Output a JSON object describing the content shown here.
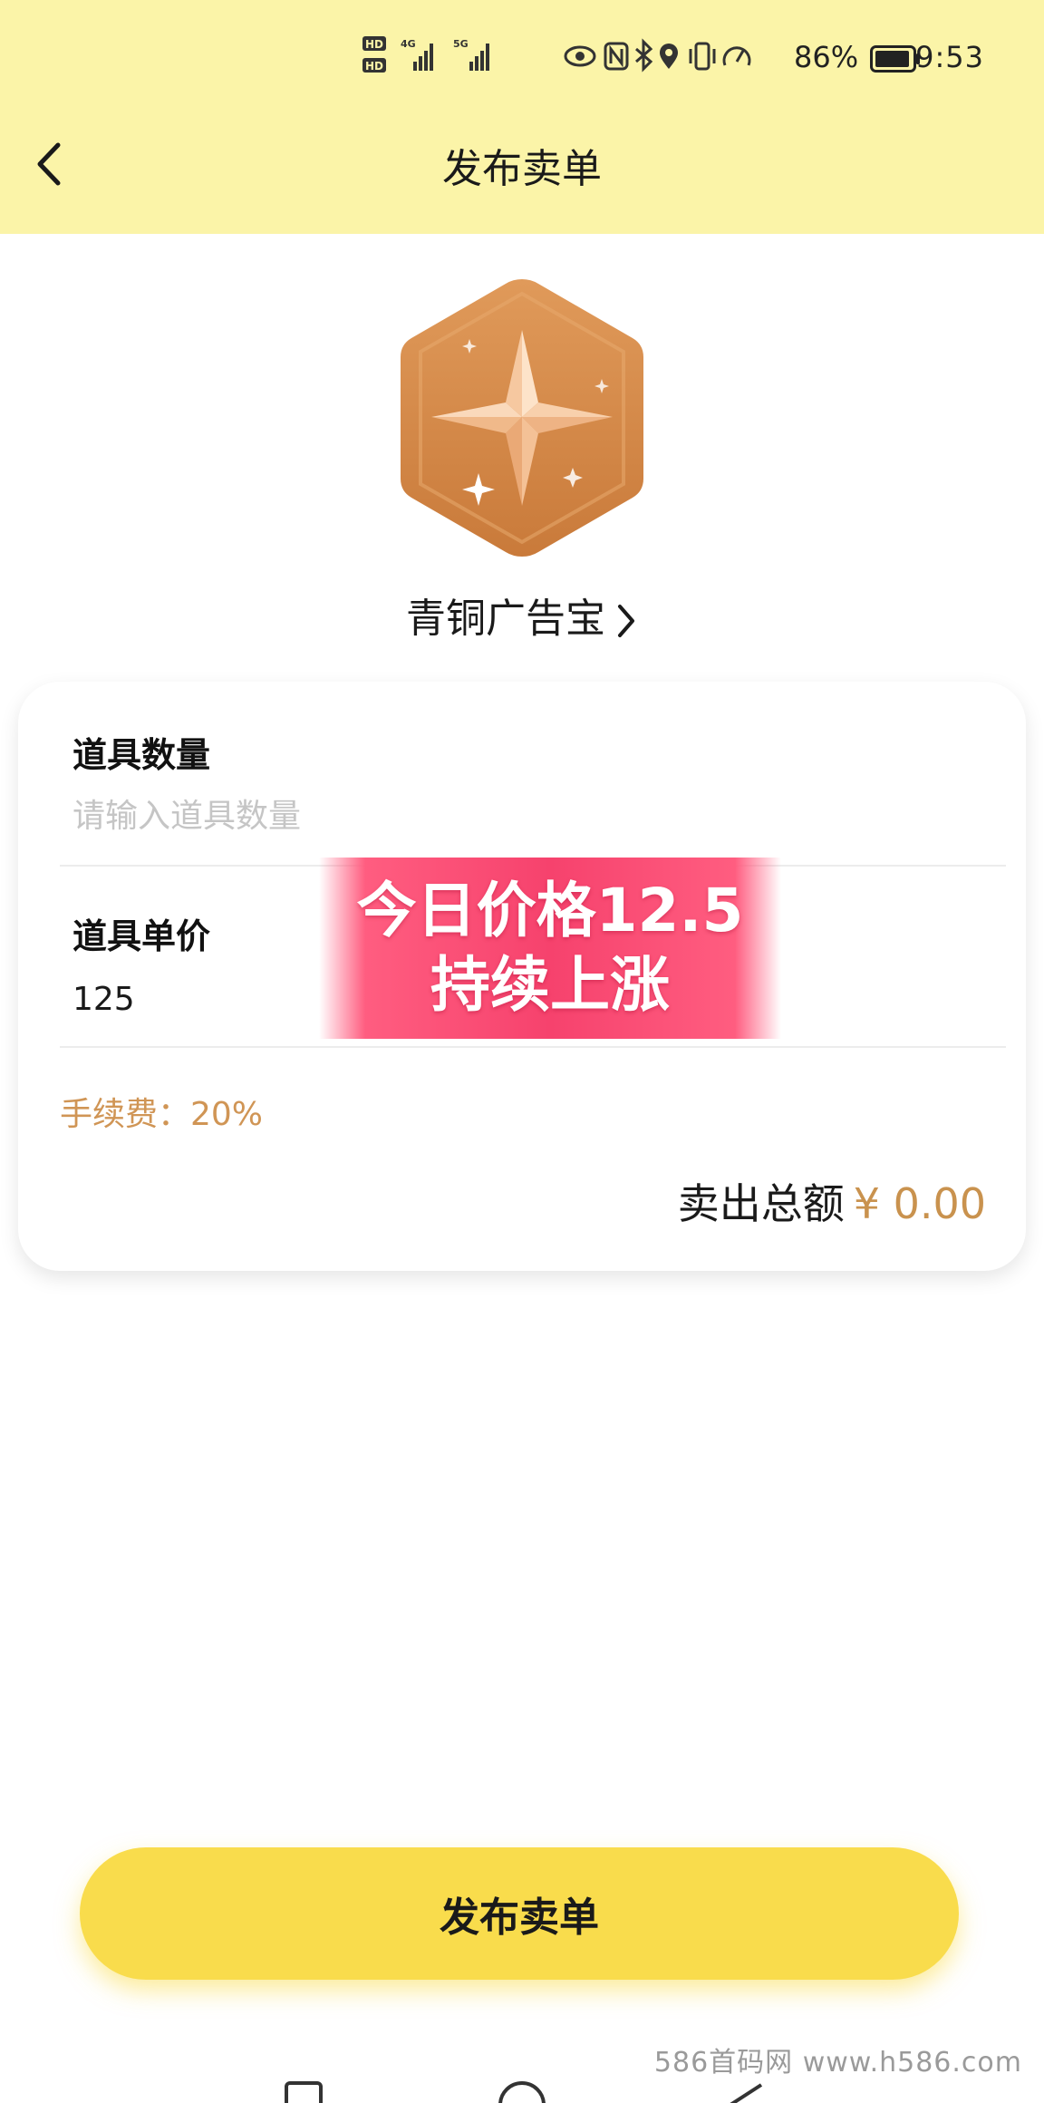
{
  "status_bar": {
    "time": "9:53",
    "battery_percent": "86%",
    "network_1": "4G",
    "network_2": "5G"
  },
  "header": {
    "title": "发布卖单",
    "background": "#fbf4a8"
  },
  "product": {
    "name": "青铜广告宝",
    "icon": "bronze-star-hexagon-icon"
  },
  "form": {
    "quantity": {
      "label": "道具数量",
      "placeholder": "请输入道具数量",
      "value": ""
    },
    "unit_price": {
      "label": "道具单价",
      "value": "125"
    },
    "fee_text": "手续费：20%",
    "total_label": "卖出总额",
    "total_amount": "¥ 0.00"
  },
  "promo": {
    "line1": "今日价格12.5",
    "line2": "持续上涨",
    "color": "#f6426d"
  },
  "actions": {
    "submit_label": "发布卖单",
    "submit_color": "#f9dc4c"
  },
  "watermark": "586首码网 www.h586.com",
  "colors": {
    "accent_orange": "#c9924e",
    "bronze": "#d38a4d"
  }
}
